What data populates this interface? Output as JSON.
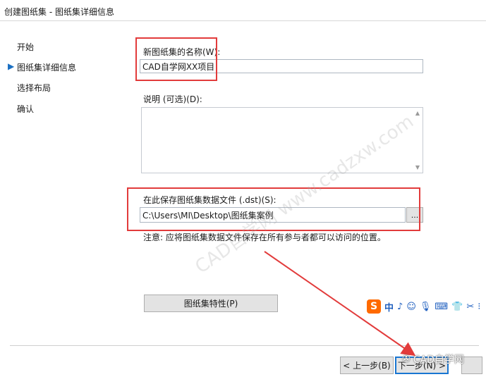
{
  "window": {
    "title": "创建图纸集 - 图纸集详细信息"
  },
  "sidebar": {
    "current_marker": "▶",
    "items": [
      {
        "label": "开始"
      },
      {
        "label": "图纸集详细信息"
      },
      {
        "label": "选择布局"
      },
      {
        "label": "确认"
      }
    ]
  },
  "form": {
    "name_label": "新图纸集的名称(W):",
    "name_value": "CAD自学网XX项目",
    "description_label": "说明 (可选)(D):",
    "description_value": "",
    "save_location_label": "在此保存图纸集数据文件 (.dst)(S):",
    "save_location_value": "C:\\Users\\MI\\Desktop\\图纸集案例",
    "browse_label": "...",
    "note": "注意: 应将图纸集数据文件保存在所有参与者都可以访问的位置。",
    "properties_button": "图纸集特性(P)"
  },
  "buttons": {
    "back": "< 上一步(B)",
    "next": "下一步(N) >"
  },
  "ime_toolbar": {
    "logo": "S",
    "mode": "中",
    "punct": "♪",
    "emoji": "☺",
    "voice": "🎙",
    "keyboard": "⌨",
    "skin": "👕",
    "tools": "✂",
    "more": "⁝"
  },
  "overlay": {
    "watermark_text": "CAD自学网 www.cadzxw.com",
    "wechat_label": "CAD自学网",
    "annotation_color": "#e23b3b"
  }
}
